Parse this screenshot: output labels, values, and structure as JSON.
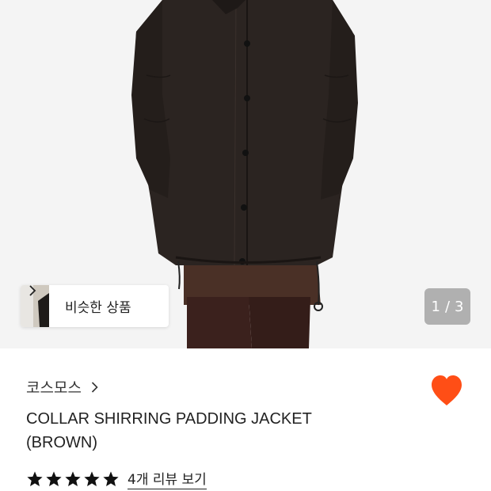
{
  "gallery": {
    "similar_products_label": "비슷한 상품",
    "current_page": "1",
    "page_separator": "/",
    "total_pages": "3"
  },
  "product": {
    "brand": "코스모스",
    "title_line1": "COLLAR SHIRRING PADDING JACKET",
    "title_line2": "(BROWN)",
    "rating": 5,
    "review_link_label": "4개 리뷰 보기"
  },
  "colors": {
    "wishlist_heart": "#ff4e16",
    "star": "#111111",
    "jacket": "#2b2421"
  },
  "icons": [
    "chevron-right-icon",
    "heart-icon",
    "star-icon"
  ]
}
